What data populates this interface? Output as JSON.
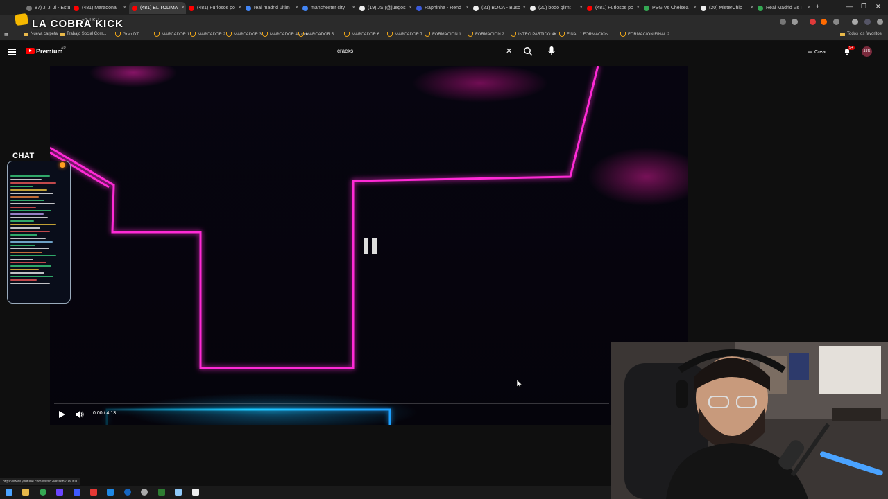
{
  "browser": {
    "tabs": [
      {
        "title": "87) Ji Ji Ji - Estu",
        "color": "#777777",
        "active": false
      },
      {
        "title": "(481) Maradona",
        "color": "#ff0000",
        "active": false
      },
      {
        "title": "(481) EL TOLIMA",
        "color": "#ff0000",
        "active": true
      },
      {
        "title": "(481) Furiosos po",
        "color": "#ff0000",
        "active": false
      },
      {
        "title": "real madrid ultim",
        "color": "#4285f4",
        "active": false
      },
      {
        "title": "manchester city",
        "color": "#4285f4",
        "active": false
      },
      {
        "title": "(19) JS (@juegos",
        "color": "#eeeeee",
        "active": false
      },
      {
        "title": "Raphinha - Rend",
        "color": "#3b5bdb",
        "active": false
      },
      {
        "title": "(21) BOCA - Busc",
        "color": "#eeeeee",
        "active": false
      },
      {
        "title": "(20) bodo glimt",
        "color": "#eeeeee",
        "active": false
      },
      {
        "title": "(481) Furiosos po",
        "color": "#ff0000",
        "active": false
      },
      {
        "title": "PSG Vs Chelsea",
        "color": "#34a853",
        "active": false
      },
      {
        "title": "(20) MisterChip",
        "color": "#eeeeee",
        "active": false
      },
      {
        "title": "Real Madrid Vs I",
        "color": "#34a853",
        "active": false
      }
    ],
    "new_tab_symbol": "+",
    "overlay_brand": "LA COBRA KICK",
    "url_fragment": "v0oLKU",
    "bookmarks": [
      "Nueva carpeta",
      "Trabajo Social Com...",
      "Gran DT",
      "MARCADOR 1",
      "MARCADOR 2",
      "MARCADOR 3",
      "MARCADOR 4 - ove...",
      "MARCADOR 5",
      "MARCADOR 6",
      "MARCADOR 7",
      "FORMACION 1",
      "FORMACION 2",
      "INTRO PARTIDO 4K",
      "FINAL 1 FORMACION",
      "FORMACION FINAL 2"
    ],
    "all_bookmarks": "Todos los favoritos",
    "status_url": "https://www.youtube.com/watch?v=sNtbV0oLKU"
  },
  "youtube": {
    "logo_text": "Premium",
    "country_code": "AR",
    "search_value": "cracks",
    "clear_symbol": "✕",
    "create_label": "Crear",
    "create_symbol": "+",
    "notifications_badge": "9+",
    "avatar_initials": "JJS"
  },
  "player": {
    "time_display": "0:00 / 4:13",
    "progress": 0.0,
    "state": "paused"
  },
  "stream_overlay": {
    "chat_title": "CHAT",
    "chat_line_colors": [
      "#3ddc84",
      "#ffffff",
      "#ff5c5c",
      "#3ddc84",
      "#ffd23f",
      "#ffffff",
      "#ff8c42",
      "#3ddc84",
      "#ffffff",
      "#ff5c5c",
      "#3ddc84",
      "#c3a6ff",
      "#ffffff",
      "#3ddc84",
      "#ffd23f",
      "#ffffff",
      "#ff5c5c",
      "#3ddc84",
      "#ffffff",
      "#8fd3ff",
      "#3ddc84",
      "#ffffff",
      "#ff8c42",
      "#3ddc84",
      "#ffffff",
      "#ff5c5c",
      "#3ddc84",
      "#ffd23f",
      "#ffffff",
      "#3ddc84",
      "#ff5c5c",
      "#ffffff"
    ]
  },
  "colors": {
    "neon_pink": "#ff2bd6",
    "neon_cyan": "#19c8ff",
    "youtube_red": "#ff0000"
  }
}
